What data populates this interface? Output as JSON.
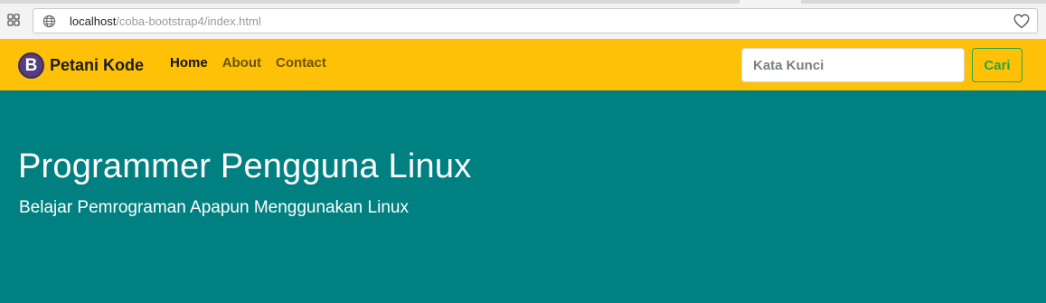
{
  "browser": {
    "url_host": "localhost",
    "url_path": "/coba-bootstrap4/index.html",
    "icons": {
      "apps": "apps-grid-icon",
      "site_info": "globe-icon",
      "bookmark": "heart-icon"
    }
  },
  "navbar": {
    "brand_logo_letter": "B",
    "brand_name": "Petani Kode",
    "links": [
      {
        "label": "Home",
        "active": true
      },
      {
        "label": "About",
        "active": false
      },
      {
        "label": "Contact",
        "active": false
      }
    ],
    "search_placeholder": "Kata Kunci",
    "search_button_label": "Cari"
  },
  "jumbotron": {
    "title": "Programmer Pengguna Linux",
    "subtitle": "Belajar Pemrograman Apapun Menggunakan Linux"
  },
  "colors": {
    "navbar_bg": "#ffc107",
    "jumbotron_bg": "#008080",
    "brand_logo": "#563d7c",
    "search_button": "#28a745"
  }
}
